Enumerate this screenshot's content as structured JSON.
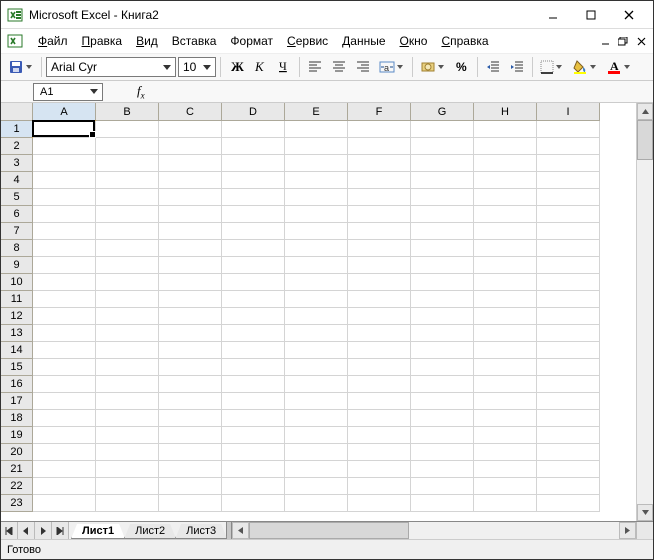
{
  "title": "Microsoft Excel - Книга2",
  "menu": {
    "file": "Файл",
    "edit": "Правка",
    "view": "Вид",
    "insert": "Вставка",
    "format": "Формат",
    "tools": "Сервис",
    "data": "Данные",
    "window": "Окно",
    "help": "Справка"
  },
  "menu_ul": {
    "file": "Ф",
    "edit": "П",
    "view": "В",
    "insert": "В",
    "format": "Ф",
    "tools": "С",
    "data": "Д",
    "window": "О",
    "help": "С"
  },
  "font": {
    "name": "Arial Cyr",
    "size": "10"
  },
  "namebox": "A1",
  "formula": "",
  "columns": [
    "A",
    "B",
    "C",
    "D",
    "E",
    "F",
    "G",
    "H",
    "I"
  ],
  "rows_count": 23,
  "active": {
    "row": 1,
    "col": "A"
  },
  "sheets": [
    {
      "name": "Лист1",
      "active": true
    },
    {
      "name": "Лист2",
      "active": false
    },
    {
      "name": "Лист3",
      "active": false
    }
  ],
  "status": "Готово"
}
